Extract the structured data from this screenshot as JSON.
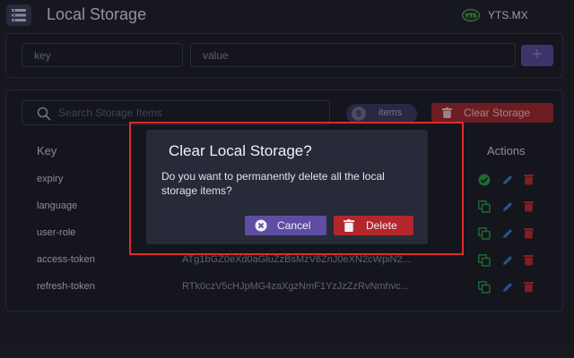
{
  "app": {
    "title": "Local Storage",
    "site_name": "YTS.MX",
    "icon": "storage-list-icon"
  },
  "add_form": {
    "key_placeholder": "key",
    "value_placeholder": "value",
    "add_label": "+"
  },
  "toolbar": {
    "search_placeholder": "Search Storage Items",
    "item_count": "5",
    "items_label": "items",
    "clear_label": "Clear Storage"
  },
  "table": {
    "columns": {
      "key": "Key",
      "actions": "Actions"
    },
    "rows": [
      {
        "key": "expiry",
        "value": ""
      },
      {
        "key": "language",
        "value": ""
      },
      {
        "key": "user-role",
        "value": ""
      },
      {
        "key": "access-token",
        "value": "ATg1bGZ0eXd0aGluZzBsMzV6ZnJ0eXN2cWpiN2..."
      },
      {
        "key": "refresh-token",
        "value": "RTk0czV5cHJpMG4zaXgzNmF1YzJzZzRvNmhvc..."
      }
    ]
  },
  "modal": {
    "title": "Clear Local Storage?",
    "message": "Do you want to permanently delete all the local storage items?",
    "cancel_label": "Cancel",
    "delete_label": "Delete"
  },
  "colors": {
    "background": "#1f2029",
    "accent_purple": "#5e4da2",
    "danger_red": "#b3272c",
    "highlight_red": "#e22a2a",
    "copy_green": "#2e9a48",
    "edit_blue": "#3a7bd5"
  }
}
